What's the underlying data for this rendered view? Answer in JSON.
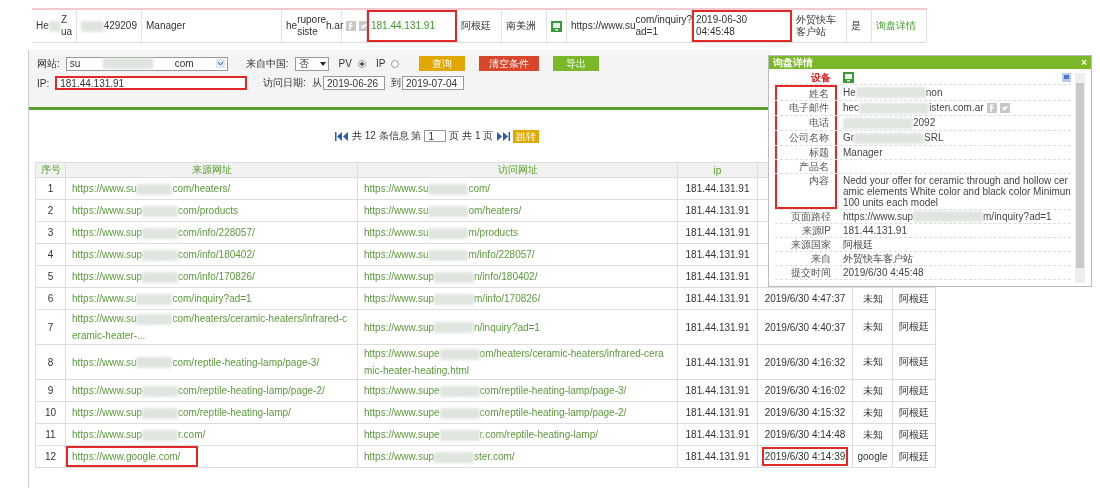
{
  "top_row": {
    "cells": [
      {
        "kind": "text",
        "parts": [
          "He",
          {
            "kind": "redacted"
          },
          "Z ua"
        ]
      },
      {
        "kind": "text",
        "parts": [
          {
            "kind": "redacted"
          },
          "429209"
        ]
      },
      {
        "kind": "text",
        "parts": [
          "Manager"
        ]
      },
      {
        "kind": "text",
        "parts": [
          "he",
          {
            "kind": "redacted"
          },
          "rupore siste",
          {
            "kind": "redacted"
          },
          "h.ar"
        ]
      },
      {
        "kind": "social"
      },
      {
        "kind": "text",
        "parts": [
          "181.44.131.91"
        ],
        "green": true,
        "highlighted": true
      },
      {
        "kind": "text",
        "parts": [
          "阿根廷"
        ]
      },
      {
        "kind": "text",
        "parts": [
          "南美洲"
        ]
      },
      {
        "kind": "device"
      },
      {
        "kind": "text",
        "parts": [
          "https://www.su",
          {
            "kind": "redacted"
          },
          "com/inquiry?ad=1"
        ]
      },
      {
        "kind": "text",
        "parts": [
          "2019-06-30 04:45:48"
        ],
        "highlighted": true
      },
      {
        "kind": "text",
        "parts": [
          "外贸快车客户站"
        ]
      },
      {
        "kind": "text",
        "parts": [
          "是"
        ]
      },
      {
        "kind": "link",
        "parts": [
          "询盘详情"
        ],
        "green": true
      }
    ]
  },
  "filters": {
    "site": {
      "label": "网站:",
      "parts": [
        "su",
        {
          "kind": "redacted"
        },
        "com"
      ]
    },
    "from_china": {
      "label": "来自中国:",
      "value": "否"
    },
    "modes": [
      {
        "label": "PV",
        "selected": true
      },
      {
        "label": "IP",
        "selected": false
      }
    ],
    "buttons": [
      {
        "label": "查询",
        "kind": "yellow"
      },
      {
        "label": "清空条件",
        "kind": "red"
      },
      {
        "label": "导出",
        "kind": "green"
      }
    ],
    "ip": {
      "label": "IP:",
      "value": "181.44.131.91",
      "highlighted": true
    },
    "date": {
      "label": "访问日期:",
      "from_label": "从",
      "from": "2019-06-26",
      "to_label": "到",
      "to": "2019-07-04"
    }
  },
  "pager": {
    "summary": "共 12 条信息 第",
    "page": "1",
    "total": "页 共 1 页",
    "go": "跳转"
  },
  "table": {
    "columns": [
      "序号",
      "来源网址",
      "访问网址",
      "ip"
    ],
    "rows": [
      {
        "no": "1",
        "source": {
          "parts": [
            "https://www.su",
            {
              "kind": "redacted"
            },
            "com/heaters/"
          ]
        },
        "visit": {
          "parts": [
            "https://www.su",
            {
              "kind": "redacted"
            },
            "com/"
          ]
        },
        "ip": "181.44.131.91"
      },
      {
        "no": "2",
        "source": {
          "parts": [
            "https://www.sup",
            {
              "kind": "redacted"
            },
            "com/products"
          ]
        },
        "visit": {
          "parts": [
            "https://www.su",
            {
              "kind": "redacted"
            },
            "om/heaters/"
          ]
        },
        "ip": "181.44.131.91"
      },
      {
        "no": "3",
        "source": {
          "parts": [
            "https://www.sup",
            {
              "kind": "redacted"
            },
            "com/info/228057/"
          ]
        },
        "visit": {
          "parts": [
            "https://www.su",
            {
              "kind": "redacted"
            },
            "m/products"
          ]
        },
        "ip": "181.44.131.91"
      },
      {
        "no": "4",
        "source": {
          "parts": [
            "https://www.sup",
            {
              "kind": "redacted"
            },
            "com/info/180402/"
          ]
        },
        "visit": {
          "parts": [
            "https://www.su",
            {
              "kind": "redacted"
            },
            "m/info/228057/"
          ]
        },
        "ip": "181.44.131.91"
      },
      {
        "no": "5",
        "source": {
          "parts": [
            "https://www.sup",
            {
              "kind": "redacted"
            },
            "com/info/170826/"
          ]
        },
        "visit": {
          "parts": [
            "https://www.sup",
            {
              "kind": "redacted"
            },
            "n/info/180402/"
          ]
        },
        "ip": "181.44.131.91"
      },
      {
        "no": "6",
        "source": {
          "parts": [
            "https://www.su",
            {
              "kind": "redacted"
            },
            "com/inquiry?ad=1"
          ]
        },
        "visit": {
          "parts": [
            "https://www.sup",
            {
              "kind": "redacted"
            },
            "m/info/170826/"
          ]
        },
        "ip": "181.44.131.91",
        "time": "2019/6/30 4:47:37",
        "from": "未知",
        "country": "阿根廷"
      },
      {
        "no": "7",
        "source": {
          "parts": [
            "https://www.su",
            {
              "kind": "redacted"
            },
            "com/heaters/ceramic-heaters/infrared-ceramic-heater-..."
          ]
        },
        "visit": {
          "parts": [
            "https://www.sup",
            {
              "kind": "redacted"
            },
            "n/inquiry?ad=1"
          ]
        },
        "ip": "181.44.131.91",
        "time": "2019/6/30 4:40:37",
        "from": "未知",
        "country": "阿根廷"
      },
      {
        "no": "8",
        "source": {
          "parts": [
            "https://www.su",
            {
              "kind": "redacted"
            },
            "com/reptile-heating-lamp/page-3/"
          ]
        },
        "visit": {
          "parts": [
            "https://www.supe",
            {
              "kind": "redacted"
            },
            "om/heaters/ceramic-heaters/infrared-ceramic-heater-heating.html"
          ]
        },
        "ip": "181.44.131.91",
        "time": "2019/6/30 4:16:32",
        "from": "未知",
        "country": "阿根廷"
      },
      {
        "no": "9",
        "source": {
          "parts": [
            "https://www.sup",
            {
              "kind": "redacted"
            },
            "com/reptile-heating-lamp/page-2/"
          ]
        },
        "visit": {
          "parts": [
            "https://www.supe",
            {
              "kind": "redacted"
            },
            "com/reptile-heating-lamp/page-3/"
          ]
        },
        "ip": "181.44.131.91",
        "time": "2019/6/30 4:16:02",
        "from": "未知",
        "country": "阿根廷"
      },
      {
        "no": "10",
        "source": {
          "parts": [
            "https://www.sup",
            {
              "kind": "redacted"
            },
            "com/reptile-heating-lamp/"
          ]
        },
        "visit": {
          "parts": [
            "https://www.supe",
            {
              "kind": "redacted"
            },
            "com/reptile-heating-lamp/page-2/"
          ]
        },
        "ip": "181.44.131.91",
        "time": "2019/6/30 4:15:32",
        "from": "未知",
        "country": "阿根廷"
      },
      {
        "no": "11",
        "source": {
          "parts": [
            "https://www.sup",
            {
              "kind": "redacted"
            },
            "r.com/"
          ]
        },
        "visit": {
          "parts": [
            "https://www.supe",
            {
              "kind": "redacted"
            },
            "r.com/reptile-heating-lamp/"
          ]
        },
        "ip": "181.44.131.91",
        "time": "2019/6/30 4:14:48",
        "from": "未知",
        "country": "阿根廷"
      },
      {
        "no": "12",
        "source": {
          "parts": [
            "https://www.google.com/"
          ],
          "highlighted": true
        },
        "visit": {
          "parts": [
            "https://www.sup",
            {
              "kind": "redacted"
            },
            "ster.com/"
          ]
        },
        "ip": "181.44.131.91",
        "time": "2019/6/30 4:14:39",
        "time_highlighted": true,
        "from": "google",
        "country": "阿根廷"
      }
    ]
  },
  "detail": {
    "title": "询盘详情",
    "close": "×",
    "rows": [
      {
        "label": "设备",
        "kind": "device",
        "highlighted": false
      },
      {
        "label": "姓名",
        "kind": "text",
        "parts": [
          "He",
          {
            "kind": "redacted"
          },
          "non"
        ],
        "highlighted": true
      },
      {
        "label": "电子邮件",
        "kind": "social",
        "parts": [
          "hec",
          {
            "kind": "redacted"
          },
          "isten.com.ar"
        ],
        "highlighted": true
      },
      {
        "label": "电话",
        "kind": "text",
        "parts": [
          {
            "kind": "redacted"
          },
          "2092"
        ],
        "highlighted": true
      },
      {
        "label": "公司名称",
        "kind": "text",
        "parts": [
          "Gr",
          {
            "kind": "redacted"
          },
          "SRL"
        ],
        "highlighted": true
      },
      {
        "label": "标题",
        "kind": "text",
        "parts": [
          "Manager"
        ],
        "highlighted": true
      },
      {
        "label": "产品名",
        "kind": "text",
        "parts": [],
        "highlighted": true
      },
      {
        "label": "内容",
        "kind": "text",
        "parts": [
          "Nedd your offer for ceramic through and hollow ceramic elements White color and black color Minimun 100 units each model"
        ],
        "highlighted": true
      },
      {
        "label": "页面路径",
        "kind": "text",
        "parts": [
          "https://www.sup",
          {
            "kind": "redacted"
          },
          "m/inquiry?ad=1"
        ],
        "highlighted": false
      },
      {
        "label": "来源IP",
        "kind": "text",
        "parts": [
          "181.44.131.91"
        ],
        "highlighted": false
      },
      {
        "label": "来源国家",
        "kind": "text",
        "parts": [
          "阿根廷"
        ],
        "highlighted": false
      },
      {
        "label": "来自",
        "kind": "text",
        "parts": [
          "外贸快车客户站"
        ],
        "highlighted": false
      },
      {
        "label": "提交时间",
        "kind": "text",
        "parts": [
          "2019/6/30 4:45:48"
        ],
        "highlighted": false
      }
    ]
  }
}
